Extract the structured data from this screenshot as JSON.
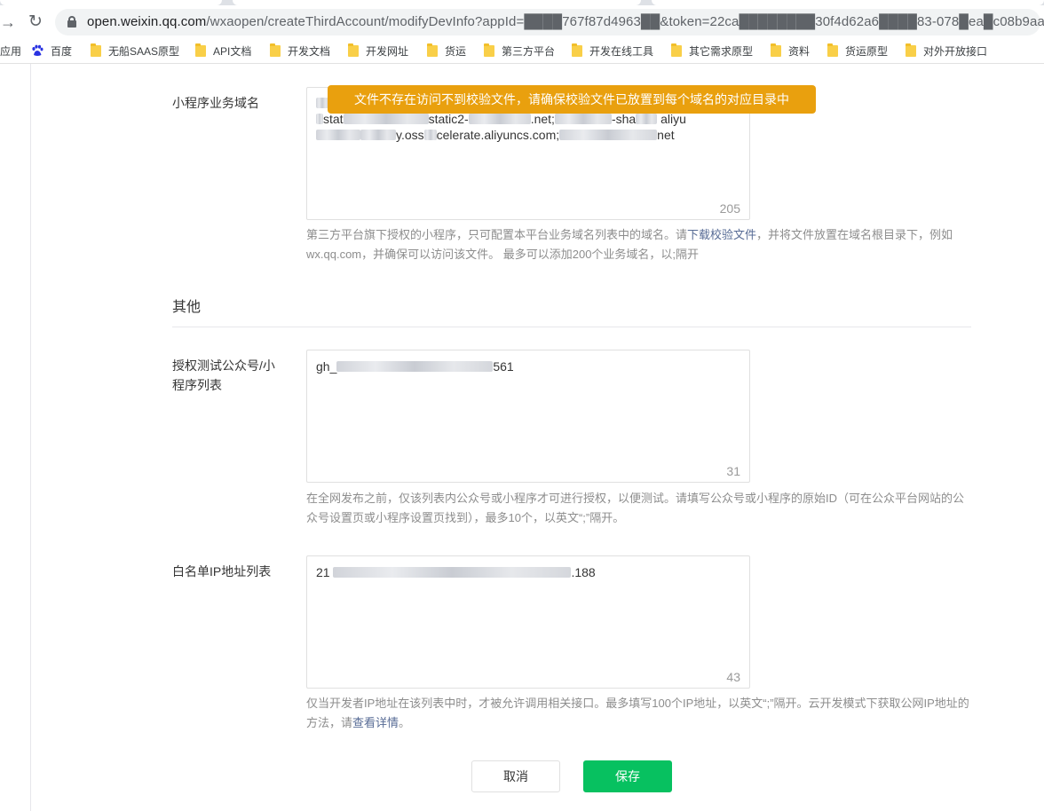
{
  "browser": {
    "url_host": "open.weixin.qq.com",
    "url_path": "/wxaopen/createThirdAccount/modifyDevInfo?appId=████767f87d4963██&token=22ca████████30f4d62a6████83-078█ea█c08b9aa",
    "bookmarks": [
      {
        "label": "应用",
        "icon": "apps-grid-icon"
      },
      {
        "label": "百度",
        "icon": "baidu-icon"
      },
      {
        "label": "无船SAAS原型",
        "icon": "folder-icon"
      },
      {
        "label": "API文档",
        "icon": "folder-icon"
      },
      {
        "label": "开发文档",
        "icon": "folder-icon"
      },
      {
        "label": "开发网址",
        "icon": "folder-icon"
      },
      {
        "label": "货运",
        "icon": "folder-icon"
      },
      {
        "label": "第三方平台",
        "icon": "folder-icon"
      },
      {
        "label": "开发在线工具",
        "icon": "folder-icon"
      },
      {
        "label": "其它需求原型",
        "icon": "folder-icon"
      },
      {
        "label": "资料",
        "icon": "folder-icon"
      },
      {
        "label": "货运原型",
        "icon": "folder-icon"
      },
      {
        "label": "对外开放接口",
        "icon": "folder-icon"
      }
    ]
  },
  "toast": {
    "message": "文件不存在访问不到校验文件，请确保校验文件已放置到每个域名的对应目录中",
    "color": "#e9a00e"
  },
  "business_domain": {
    "label": "小程序业务域名",
    "value_line1_end": ".net;",
    "value_line1_part": "static2-",
    "value_line1_tail": "-sha",
    "value_line1_word": "aliyu",
    "value_line2_part": "y.oss",
    "value_line2_mid": "celerate.aliyuncs.com;",
    "value_line2_end": "net",
    "value_prefix": "stat",
    "char_count": "205",
    "hint_before_link": "第三方平台旗下授权的小程序，只可配置本平台业务域名列表中的域名。请",
    "hint_link": "下载校验文件",
    "hint_after_link": "，并将文件放置在域名根目录下，例如wx.qq.com，并确保可以访问该文件。 最多可以添加200个业务域名，以;隔开"
  },
  "section_other": {
    "title": "其他"
  },
  "test_accounts": {
    "label": "授权测试公众号/小程序列表",
    "value_prefix": "gh_",
    "value_suffix": "561",
    "char_count": "31",
    "hint": "在全网发布之前，仅该列表内公众号或小程序才可进行授权，以便测试。请填写公众号或小程序的原始ID（可在公众平台网站的公众号设置页或小程序设置页找到），最多10个，以英文“;”隔开。"
  },
  "ip_whitelist": {
    "label": "白名单IP地址列表",
    "value_prefix": "21",
    "value_suffix": ".188",
    "char_count": "43",
    "hint_before_link": "仅当开发者IP地址在该列表中时，才被允许调用相关接口。最多填写100个IP地址，以英文“;”隔开。云开发模式下获取公网IP地址的方法，请",
    "hint_link": "查看详情",
    "hint_after_link": "。"
  },
  "actions": {
    "cancel_label": "取消",
    "save_label": "保存",
    "save_color": "#07c160"
  }
}
